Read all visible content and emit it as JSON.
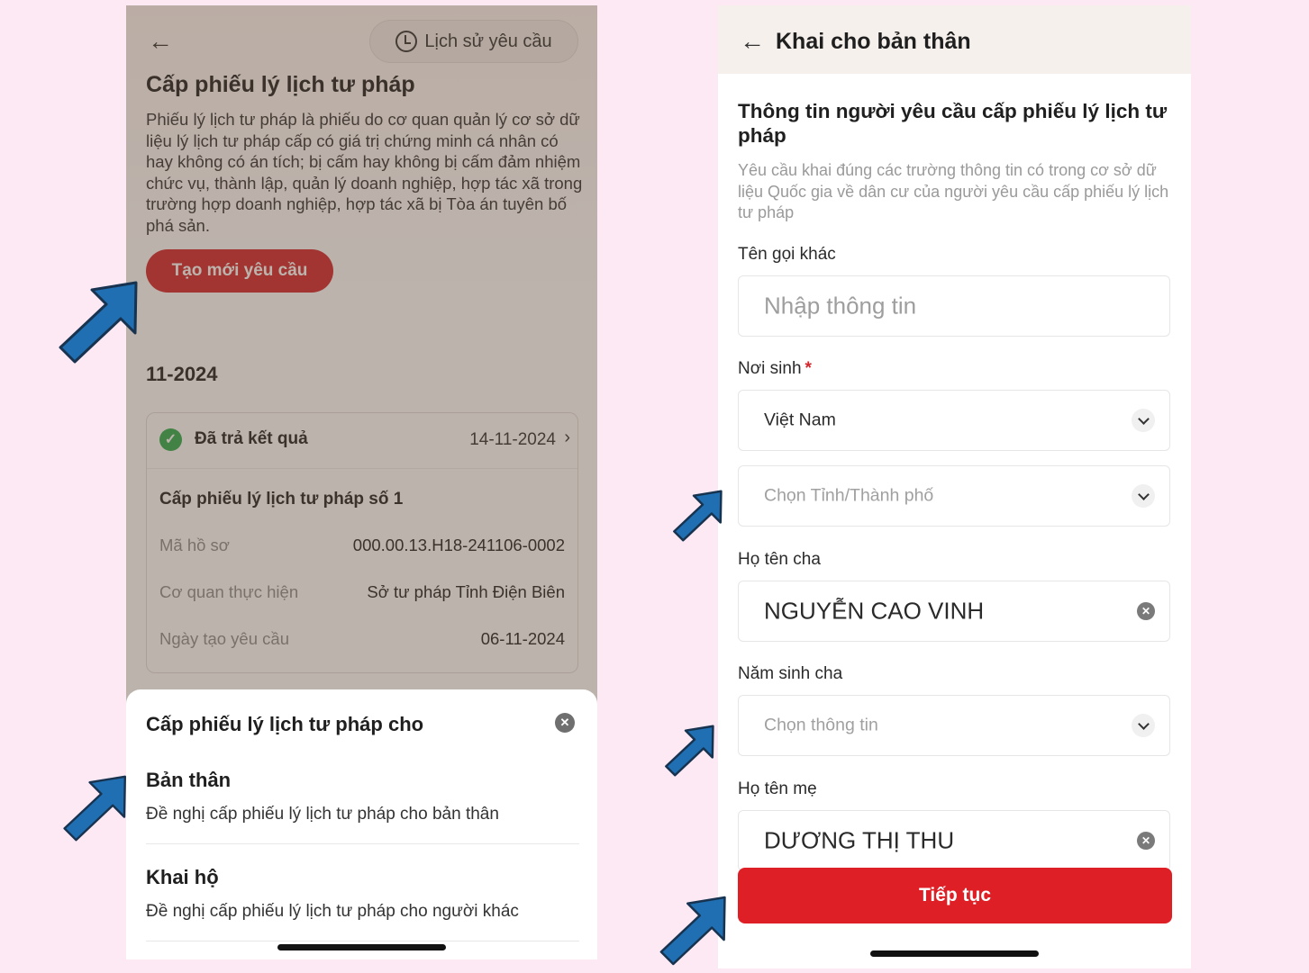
{
  "left_screen": {
    "history_button": "Lịch sử yêu cầu",
    "title": "Cấp phiếu lý lịch tư pháp",
    "description": "Phiếu lý lịch tư pháp là phiếu do cơ quan quản lý cơ sở dữ liệu lý lịch tư pháp cấp có giá trị chứng minh cá nhân có hay không có án tích; bị cấm hay không bị cấm đảm nhiệm chức vụ, thành lập, quản lý doanh nghiệp, hợp tác xã trong trường hợp doanh nghiệp, hợp tác xã bị Tòa án tuyên bố phá sản.",
    "create_button": "Tạo mới yêu cầu",
    "month_header": "11-2024",
    "card": {
      "status": "Đã trả kết quả",
      "date": "14-11-2024",
      "title": "Cấp phiếu lý lịch tư pháp số 1",
      "rows": [
        {
          "label": "Mã hồ sơ",
          "value": "000.00.13.H18-241106-0002"
        },
        {
          "label": "Cơ quan thực hiện",
          "value": "Sở tư pháp Tỉnh Điện Biên"
        },
        {
          "label": "Ngày tạo yêu cầu",
          "value": "06-11-2024"
        }
      ]
    },
    "sheet": {
      "title": "Cấp phiếu lý lịch tư pháp cho",
      "options": [
        {
          "title": "Bản thân",
          "desc": "Đề nghị cấp phiếu lý lịch tư pháp cho bản thân"
        },
        {
          "title": "Khai hộ",
          "desc": "Đề nghị cấp phiếu lý lịch tư pháp cho người khác"
        }
      ]
    }
  },
  "right_screen": {
    "header_title": "Khai cho bản thân",
    "section_title": "Thông tin người yêu cầu cấp phiếu lý lịch tư pháp",
    "section_desc": "Yêu cầu khai đúng các trường thông tin có trong cơ sở dữ liệu Quốc gia về dân cư của người yêu cầu cấp phiếu lý lịch tư pháp",
    "fields": {
      "other_name": {
        "label": "Tên gọi khác",
        "placeholder": "Nhập thông tin"
      },
      "birthplace": {
        "label": "Nơi sinh",
        "required_mark": "*",
        "country": "Việt Nam",
        "province_placeholder": "Chọn Tỉnh/Thành phố"
      },
      "father_name": {
        "label": "Họ tên cha",
        "value": "NGUYỄN CAO VINH"
      },
      "father_birth_year": {
        "label": "Năm sinh cha",
        "placeholder": "Chọn thông tin"
      },
      "mother_name": {
        "label": "Họ tên mẹ",
        "value": "DƯƠNG THỊ THU"
      }
    },
    "continue_button": "Tiếp tục"
  },
  "colors": {
    "background": "#fce9f4",
    "accent_red": "#d3262a",
    "arrow_blue": "#1f6fb2",
    "success_green": "#2eab4a"
  }
}
